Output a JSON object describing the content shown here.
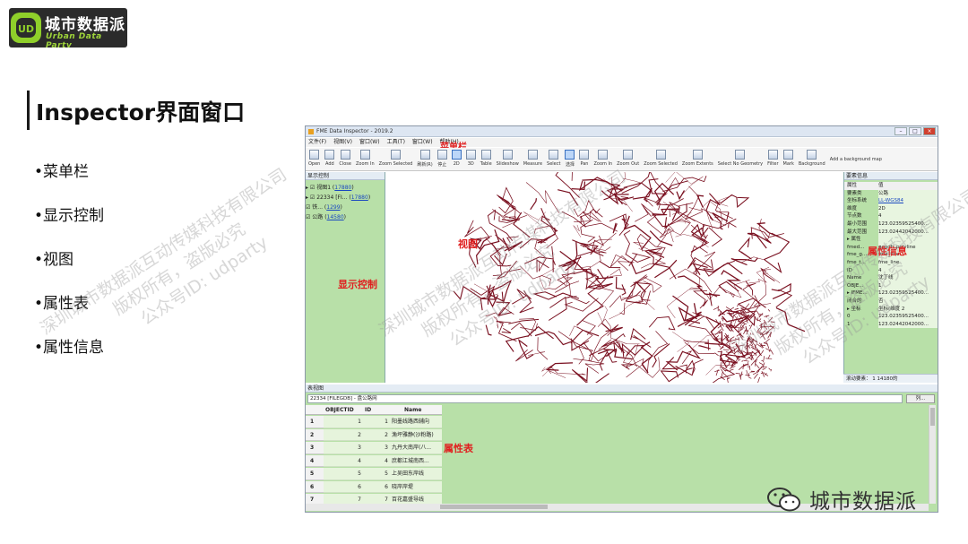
{
  "logo": {
    "name": "城市数据派",
    "tagline": "Urban Data Party"
  },
  "slide": {
    "title": "Inspector界面窗口",
    "bullets": [
      "•菜单栏",
      "•显示控制",
      "•视图",
      "•属性表",
      "•属性信息"
    ]
  },
  "watermark": {
    "line1": "深圳城市数据派互动传媒科技有限公司",
    "line2": "版权所有，盗版必究",
    "line3": "公众号ID: udparty"
  },
  "app": {
    "window_title": "FME Data Inspector - 2019.2",
    "menu": [
      "文件(F)",
      "视图(V)",
      "窗口(W)",
      "工具(T)",
      "窗口(W)",
      "帮助(H)"
    ],
    "toolbar": [
      "Open",
      "Add",
      "Close",
      "Zoom In",
      "Zoom Selected",
      "刷新(R)",
      "停止",
      "2D",
      "3D",
      "Table",
      "Slideshow",
      "Measure",
      "Select",
      "选择",
      "Pan",
      "Zoom In",
      "Zoom Out",
      "Zoom Selected",
      "Zoom Extents",
      "Select No Geometry",
      "Filter",
      "Mark",
      "Background",
      "Add a background map"
    ],
    "labels": {
      "menubar": "菜单栏",
      "display_control": "显示控制",
      "view": "视图",
      "attr_info": "属性信息",
      "attr_table": "属性表"
    },
    "left_panel": {
      "title": "显示控制",
      "nodes": [
        {
          "prefix": "▸ ☑ 视图1 (",
          "link": "17880",
          "suffix": ")"
        },
        {
          "prefix": "  ▸ ☑ 22334 [FI... (",
          "link": "17880",
          "suffix": ")"
        },
        {
          "prefix": "      ☑ 铁... (",
          "link": "1299",
          "suffix": ")"
        },
        {
          "prefix": "      ☑ 公路 (",
          "link": "14580",
          "suffix": ")"
        }
      ]
    },
    "right_panel": {
      "title": "要素信息",
      "header_k": "属性",
      "header_v": "值",
      "rows": [
        {
          "k": "要素类",
          "v": "公路"
        },
        {
          "k": "坐标系统",
          "v": "LL-WGS84",
          "link": true
        },
        {
          "k": "维度",
          "v": "2D"
        },
        {
          "k": "节点数",
          "v": "4"
        },
        {
          "k": "最小范围",
          "v": "123.02359525400..."
        },
        {
          "k": "最大范围",
          "v": "123.02442042000..."
        },
        {
          "k": "▸ 属性",
          "v": ""
        },
        {
          "k": "fmed...",
          "v": "geodb_polyline"
        },
        {
          "k": "fme_g...",
          "v": "fme_line"
        },
        {
          "k": "fme_t...",
          "v": "fme_line"
        },
        {
          "k": "ID",
          "v": "4"
        },
        {
          "k": "Name",
          "v": "沈丁线"
        },
        {
          "k": "OBJE...",
          "v": "1"
        },
        {
          "k": "▸ IFME...",
          "v": "123.02359525400..."
        },
        {
          "k": "闭合的",
          "v": "否"
        },
        {
          "k": "▸ 坐标",
          "v": "坐标(维度 2"
        },
        {
          "k": "0",
          "v": "123.02359525400..."
        },
        {
          "k": "1",
          "v": "123.02442042000..."
        }
      ],
      "status": "滚动要素：  1  14180的"
    },
    "table": {
      "title": "表视图",
      "combo": "22334 [FILEGDB] - 盘公路网",
      "btn": "列...",
      "columns": [
        "OBJECTID",
        "ID",
        "Name"
      ],
      "rows": [
        [
          "1",
          "1",
          "1",
          "阳墨线路西辅向"
        ],
        [
          "2",
          "2",
          "2",
          "漁坪雅静(沙粉路)"
        ],
        [
          "3",
          "3",
          "3",
          "九丹大南岸(八..."
        ],
        [
          "4",
          "4",
          "4",
          "庶都江城南西..."
        ],
        [
          "5",
          "5",
          "5",
          "上吴田东岸线"
        ],
        [
          "6",
          "6",
          "6",
          "晓岸岸堤"
        ],
        [
          "7",
          "7",
          "7",
          "百花嘉盛导线"
        ]
      ]
    }
  },
  "footer": {
    "brand": "城市数据派"
  },
  "colors": {
    "panel_green": "#b8e0a8",
    "label_red": "#e02020",
    "road": "#7a1020"
  }
}
